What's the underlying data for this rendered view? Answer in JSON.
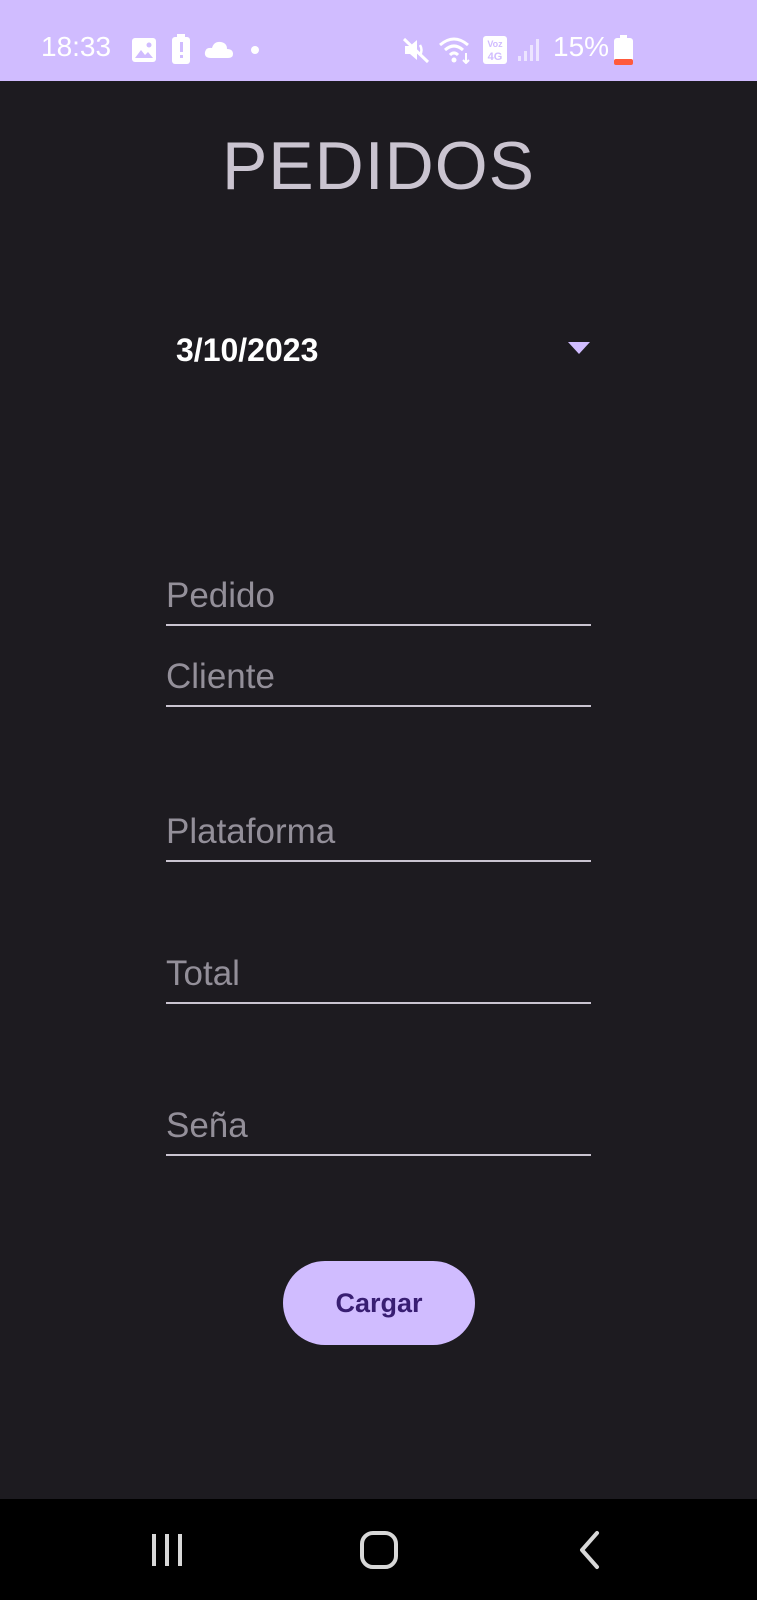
{
  "status_bar": {
    "time": "18:33",
    "battery_percent": "15%",
    "icons": [
      "gallery-icon",
      "battery-alert-icon",
      "cloud-icon",
      "dot-icon",
      "mute-icon",
      "wifi-icon",
      "volte-4g-icon",
      "signal-icon",
      "battery-icon"
    ]
  },
  "app": {
    "title": "PEDIDOS"
  },
  "date_spinner": {
    "selected": "3/10/2023"
  },
  "form": {
    "fields": [
      {
        "placeholder": "Pedido",
        "value": ""
      },
      {
        "placeholder": "Cliente",
        "value": ""
      },
      {
        "placeholder": "Plataforma",
        "value": ""
      },
      {
        "placeholder": "Total",
        "value": ""
      },
      {
        "placeholder": "Seña",
        "value": ""
      }
    ],
    "submit_label": "Cargar"
  },
  "nav_bar": {
    "buttons": [
      "recent-apps-icon",
      "home-icon",
      "back-icon"
    ]
  },
  "colors": {
    "accent": "#d0bcff",
    "background": "#1d1b20",
    "on_accent": "#381e72",
    "battery_low": "#ff5a3c"
  }
}
